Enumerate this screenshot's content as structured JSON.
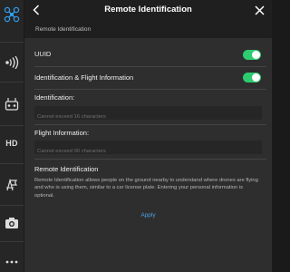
{
  "window": {
    "title": "Remote Identification",
    "back_icon": "chevron-left-icon",
    "close_icon": "close-icon"
  },
  "sidebar": {
    "items": [
      {
        "name": "aircraft-settings",
        "icon": "drone-icon"
      },
      {
        "name": "signal",
        "icon": "signal-icon"
      },
      {
        "name": "remote-controller",
        "icon": "remote-controller-icon"
      },
      {
        "name": "hd-transmission",
        "icon": "hd-icon",
        "label": "HD"
      },
      {
        "name": "general",
        "icon": "map-flag-icon"
      },
      {
        "name": "camera",
        "icon": "camera-icon"
      },
      {
        "name": "more",
        "icon": "more-icon"
      }
    ]
  },
  "section": {
    "header": "Remote Identification"
  },
  "settings": {
    "uuid": {
      "label": "UUID",
      "enabled": true
    },
    "id_flight_info": {
      "label": "Identification & Flight Information",
      "enabled": true
    }
  },
  "identification": {
    "label": "Identification:",
    "placeholder": "Cannot exceed 16 characters",
    "value": ""
  },
  "flight_information": {
    "label": "Flight Information:",
    "placeholder": "Cannot exceed 90 characters",
    "value": ""
  },
  "info": {
    "title": "Remote Identification",
    "description": "Remote Identification allows people on the ground nearby to understand where drones are flying and who is using them, similar to a car license plate. Entering your personal information is optional."
  },
  "actions": {
    "apply_label": "Apply"
  },
  "colors": {
    "accent": "#4aa3e8",
    "toggle_on": "#2ecc71",
    "panel_bg": "#2e2e2e",
    "header_bg": "#1f1f1f",
    "sidebar_bg": "#262626",
    "drone_icon": "#2f9bea"
  }
}
